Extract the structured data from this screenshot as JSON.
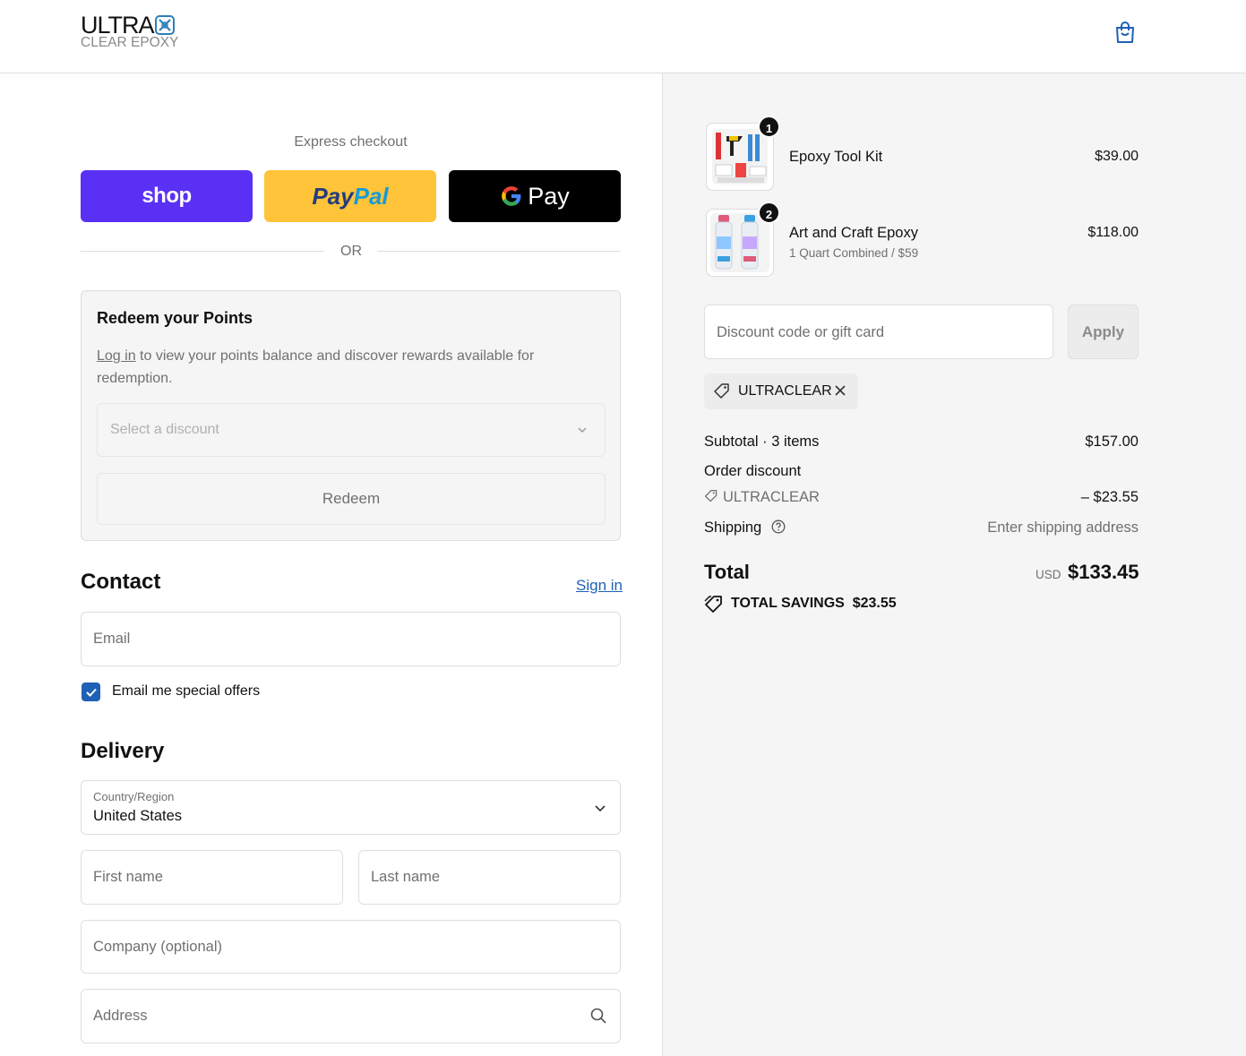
{
  "header": {
    "logo_line1": "ULTRA",
    "logo_line2": "CLEAR EPOXY",
    "cart_icon": "shopping-bag-icon"
  },
  "express": {
    "title": "Express checkout",
    "shop_label": "shop",
    "paypal_label_1": "Pay",
    "paypal_label_2": "Pal",
    "gpay_g": "G",
    "gpay_label": "Pay",
    "or_label": "OR"
  },
  "points": {
    "title": "Redeem your Points",
    "login_link": "Log in",
    "text": " to view your points balance and discover rewards available for redemption.",
    "select_placeholder": "Select a discount",
    "redeem_label": "Redeem"
  },
  "contact": {
    "heading": "Contact",
    "sign_in": "Sign in",
    "email_placeholder": "Email",
    "offers_label": "Email me special offers",
    "offers_checked": true
  },
  "delivery": {
    "heading": "Delivery",
    "country_label": "Country/Region",
    "country_value": "United States",
    "first_name_placeholder": "First name",
    "last_name_placeholder": "Last name",
    "company_placeholder": "Company (optional)",
    "address_placeholder": "Address"
  },
  "cart_items": [
    {
      "name": "Epoxy Tool Kit",
      "variant": "",
      "qty": "1",
      "price": "$39.00"
    },
    {
      "name": "Art and Craft Epoxy",
      "variant": "1 Quart Combined / $59",
      "qty": "2",
      "price": "$118.00"
    }
  ],
  "discount": {
    "placeholder": "Discount code or gift card",
    "apply_label": "Apply",
    "applied_code": "ULTRACLEAR"
  },
  "summary": {
    "subtotal_label": "Subtotal · 3 items",
    "subtotal_value": "$157.00",
    "order_discount_label": "Order discount",
    "discount_code": "ULTRACLEAR",
    "discount_value": "– $23.55",
    "shipping_label": "Shipping",
    "shipping_value": "Enter shipping address",
    "total_label": "Total",
    "currency": "USD",
    "total_value": "$133.45",
    "savings_label": "TOTAL SAVINGS",
    "savings_value": "$23.55"
  },
  "colors": {
    "shop_purple": "#5a31f4",
    "paypal_yellow": "#ffc439",
    "link_blue": "#1f61b5",
    "panel_grey": "#f5f5f5"
  }
}
